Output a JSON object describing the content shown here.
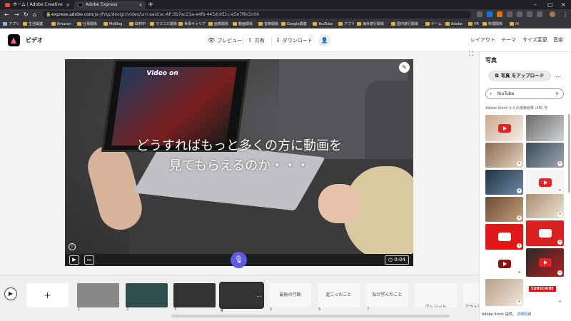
{
  "browser": {
    "tabs": [
      {
        "title": "ホーム | Adobe Creative Cloud"
      },
      {
        "title": "Adobe Express"
      }
    ],
    "new_tab": "+",
    "url_host": "express.adobe.com",
    "url_path": "/ja-JP/sp/design/video/urn:aaid:sc:AP:3b7ac21a-a4fb-445d-951c-e5e7f6c5c04",
    "bookmarks": [
      "アプリ",
      "生活関連",
      "Amazon",
      "仕事関係",
      "MyBlog",
      "取材中",
      "マスコミ関係",
      "世事キャリア",
      "画像関係",
      "動画関係",
      "音楽関係",
      "Google関連",
      "YouTube",
      "アプリ",
      "海外旅行関係",
      "国内旅行関係",
      "ゲーム",
      "Adobe",
      "VR",
      "料理関係",
      "AI"
    ]
  },
  "header": {
    "title": "ビデオ",
    "preview": "プレビュー",
    "share": "共有",
    "download": "ダウンロード",
    "nav": [
      "レイアウト",
      "テーマ",
      "サイズ変更",
      "音楽"
    ]
  },
  "canvas": {
    "caption_line1": "どうすればもっと多くの方に動画を",
    "caption_line2": "見てもらえるのか・・・",
    "laptop_screen_title": "Video on",
    "duration": "0:04"
  },
  "timeline": {
    "add_label": "+",
    "scenes": [
      {
        "num": "1",
        "label": "",
        "style": "thumb-gray"
      },
      {
        "num": "2",
        "label": "",
        "style": "thumb-teal"
      },
      {
        "num": "3",
        "label": "",
        "style": "thumb-dark"
      },
      {
        "num": "4",
        "label": "",
        "style": "thumb-dark"
      },
      {
        "num": "5",
        "label": "最後の行動",
        "style": "thumb-light"
      },
      {
        "num": "6",
        "label": "起こったこと",
        "style": "thumb-light"
      },
      {
        "num": "7",
        "label": "私が学んだこと",
        "style": "thumb-light"
      },
      {
        "num": "",
        "label": "クレジット",
        "style": "thumb-light"
      },
      {
        "num": "",
        "label": "アウトロ",
        "style": "thumb-light"
      }
    ]
  },
  "panel": {
    "title": "写真",
    "upload": "写真 をアップロード",
    "more": "…",
    "search_value": "YouTube",
    "search_clear": "×",
    "stock_header": "Adobe Stock からの検索結果 (4M) 件",
    "subscribe_label": "SUBSCRIBE",
    "footer_text": "Adobe Stock 提供。",
    "footer_link": "詳細情報"
  }
}
